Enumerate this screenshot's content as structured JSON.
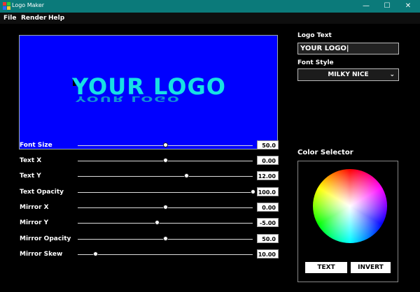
{
  "window": {
    "title": "Logo Maker",
    "controls": {
      "minimize": "—",
      "maximize": "☐",
      "close": "✕"
    }
  },
  "menu": {
    "items": [
      "File",
      "Render",
      "Help"
    ]
  },
  "preview": {
    "logo_text": "YOUR LOGO",
    "mirror_text": "YOUR LOGO",
    "background_color": "#0000ff",
    "text_color": "#17e0e4"
  },
  "sliders": [
    {
      "label": "Font Size",
      "value": "50.0",
      "level": 0.5
    },
    {
      "label": "Text X",
      "value": "0.00",
      "level": 0.5
    },
    {
      "label": "Text Y",
      "value": "12.00",
      "level": 0.62
    },
    {
      "label": "Text Opacity",
      "value": "100.0",
      "level": 1.0
    },
    {
      "label": "Mirror X",
      "value": "0.00",
      "level": 0.5
    },
    {
      "label": "Mirror Y",
      "value": "-5.00",
      "level": 0.45
    },
    {
      "label": "Mirror Opacity",
      "value": "50.0",
      "level": 0.5
    },
    {
      "label": "Mirror Skew",
      "value": "10.00",
      "level": 0.1
    }
  ],
  "right_panel": {
    "logo_text_label": "Logo Text",
    "logo_text_value": "YOUR LOGO|",
    "font_style_label": "Font Style",
    "font_style_value": "MILKY NICE",
    "color_selector_label": "Color Selector",
    "text_button": "TEXT",
    "invert_button": "INVERT"
  }
}
